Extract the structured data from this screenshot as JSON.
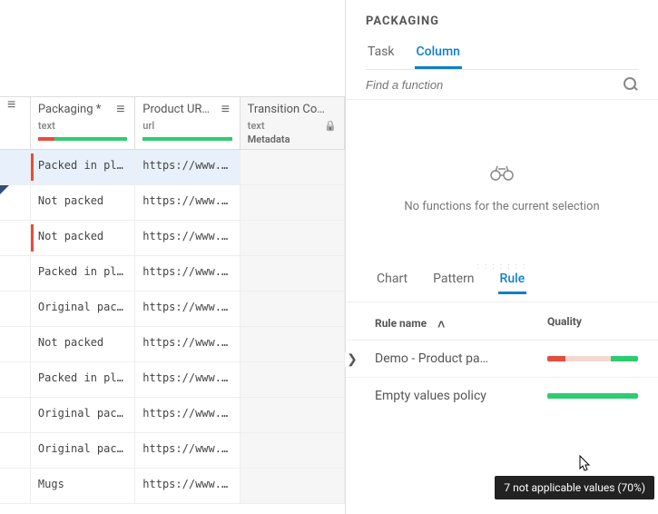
{
  "grid": {
    "columns": [
      {
        "title": "",
        "type": ""
      },
      {
        "title": "Packaging *",
        "type": "text"
      },
      {
        "title": "Product UR…",
        "type": "url"
      },
      {
        "title": "Transition Co…",
        "type": "text",
        "meta": "Metadata"
      }
    ],
    "rows": [
      {
        "packaging": "Packed in plast…",
        "url": "https://www.goo…",
        "selected": true,
        "flag": true
      },
      {
        "packaging": "Not packed",
        "url": "https://www.goo…",
        "corner": true
      },
      {
        "packaging": "Not packed",
        "url": "https://www.goo…",
        "flag": true
      },
      {
        "packaging": "Packed in plast…",
        "url": "https://www.goo…"
      },
      {
        "packaging": "Original packag…",
        "url": "https://www.goo…"
      },
      {
        "packaging": "Not packed",
        "url": "https://www.goo…"
      },
      {
        "packaging": "Packed in plast…",
        "url": "https://www.goo…"
      },
      {
        "packaging": "Original packag…",
        "url": "https://www.goo…"
      },
      {
        "packaging": "Original packag…",
        "url": "https://www.goo…"
      },
      {
        "packaging": "Mugs",
        "url": "https://www.goo…"
      }
    ]
  },
  "panel": {
    "title": "PACKAGING",
    "top_tabs": {
      "task": "Task",
      "column": "Column"
    },
    "search_placeholder": "Find a function",
    "empty_message": "No functions for the current selection",
    "bottom_tabs": {
      "chart": "Chart",
      "pattern": "Pattern",
      "rule": "Rule"
    },
    "rule_header": {
      "name": "Rule name",
      "quality": "Quality"
    },
    "rules": [
      {
        "label": "Demo - Product pa…",
        "red": 20,
        "gap": 50,
        "green": 30
      },
      {
        "label": "Empty values policy",
        "red": 0,
        "gap": 0,
        "green": 100
      }
    ],
    "tooltip": "7 not applicable values (70%)"
  }
}
